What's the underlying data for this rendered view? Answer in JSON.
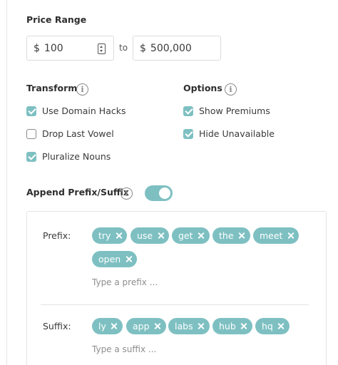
{
  "price_range": {
    "title": "Price Range",
    "min": {
      "currency": "$",
      "value": "100"
    },
    "separator": "to",
    "max": {
      "currency": "$",
      "value": "500,000"
    }
  },
  "transform": {
    "title": "Transform",
    "options": [
      {
        "label": "Use Domain Hacks",
        "checked": true
      },
      {
        "label": "Drop Last Vowel",
        "checked": false
      },
      {
        "label": "Pluralize Nouns",
        "checked": true
      }
    ]
  },
  "options": {
    "title": "Options",
    "items": [
      {
        "label": "Show Premiums",
        "checked": true
      },
      {
        "label": "Hide Unavailable",
        "checked": true
      }
    ]
  },
  "append": {
    "title": "Append Prefix/Suffix",
    "enabled": true
  },
  "prefix": {
    "label": "Prefix:",
    "chips": [
      "try",
      "use",
      "get",
      "the",
      "meet",
      "open"
    ],
    "placeholder": "Type a prefix ..."
  },
  "suffix": {
    "label": "Suffix:",
    "chips": [
      "ly",
      "app",
      "labs",
      "hub",
      "hq"
    ],
    "placeholder": "Type a suffix ..."
  },
  "colors": {
    "accent": "#7ec0c2",
    "border": "#dcdcdc",
    "text": "#3a3a3a"
  },
  "icons": {
    "info": "info-icon",
    "stepper": "number-stepper-icon",
    "remove": "close-icon"
  }
}
